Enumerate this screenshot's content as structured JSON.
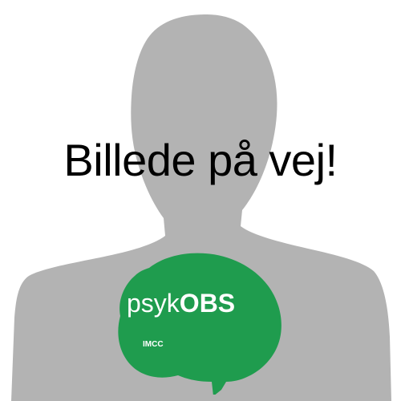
{
  "caption": "Billede på vej!",
  "logo": {
    "brand_light": "psyk",
    "brand_bold": "OBS",
    "sub_label": "IMCC"
  },
  "colors": {
    "background": "#ffffff",
    "silhouette": "#b3b3b3",
    "logo_green": "#1f9c4e",
    "logo_text": "#ffffff",
    "caption_text": "#000000"
  }
}
